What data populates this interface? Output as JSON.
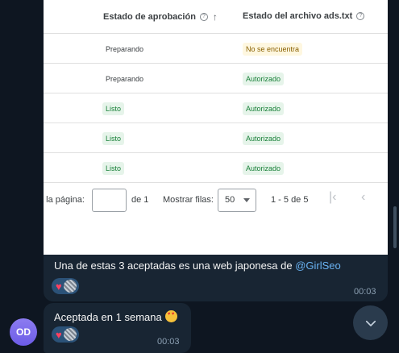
{
  "table": {
    "col_approval": "Estado de aprobación",
    "col_ads": "Estado del archivo ads.txt",
    "sort_arrow": "↑",
    "rows": [
      {
        "approval": "Preparando",
        "ads": "No se encuentra"
      },
      {
        "approval": "Preparando",
        "ads": "Autorizado"
      },
      {
        "approval": "Listo",
        "ads": "Autorizado"
      },
      {
        "approval": "Listo",
        "ads": "Autorizado"
      },
      {
        "approval": "Listo",
        "ads": "Autorizado"
      }
    ]
  },
  "pager": {
    "page_label": "a la página:",
    "page_total": "de 1",
    "rows_label": "Mostrar filas:",
    "rows_value": "50",
    "range": "1 - 5 de 5"
  },
  "message1": {
    "text": "Una de estas 3 aceptadas es una web japonesa de ",
    "mention": "@GirlSeo",
    "time": "00:03"
  },
  "message2": {
    "text": "Aceptada en 1 semana",
    "time": "00:03"
  },
  "avatar": {
    "initials": "OD"
  },
  "icons": {
    "help": "help-circle-icon",
    "sort": "arrow-up-icon",
    "first_page": "first-page-icon",
    "prev_page": "chevron-left-icon",
    "scroll_down": "chevron-down-icon",
    "heart": "heart-icon",
    "emoji": "heart-eyes-emoji-icon"
  },
  "colors": {
    "chat_bg": "#0e1621",
    "bubble": "#182533",
    "mention": "#6ab3f3",
    "status_green_bg": "#e6f4ea",
    "status_green": "#188038",
    "status_yellow_bg": "#fef7e0"
  }
}
